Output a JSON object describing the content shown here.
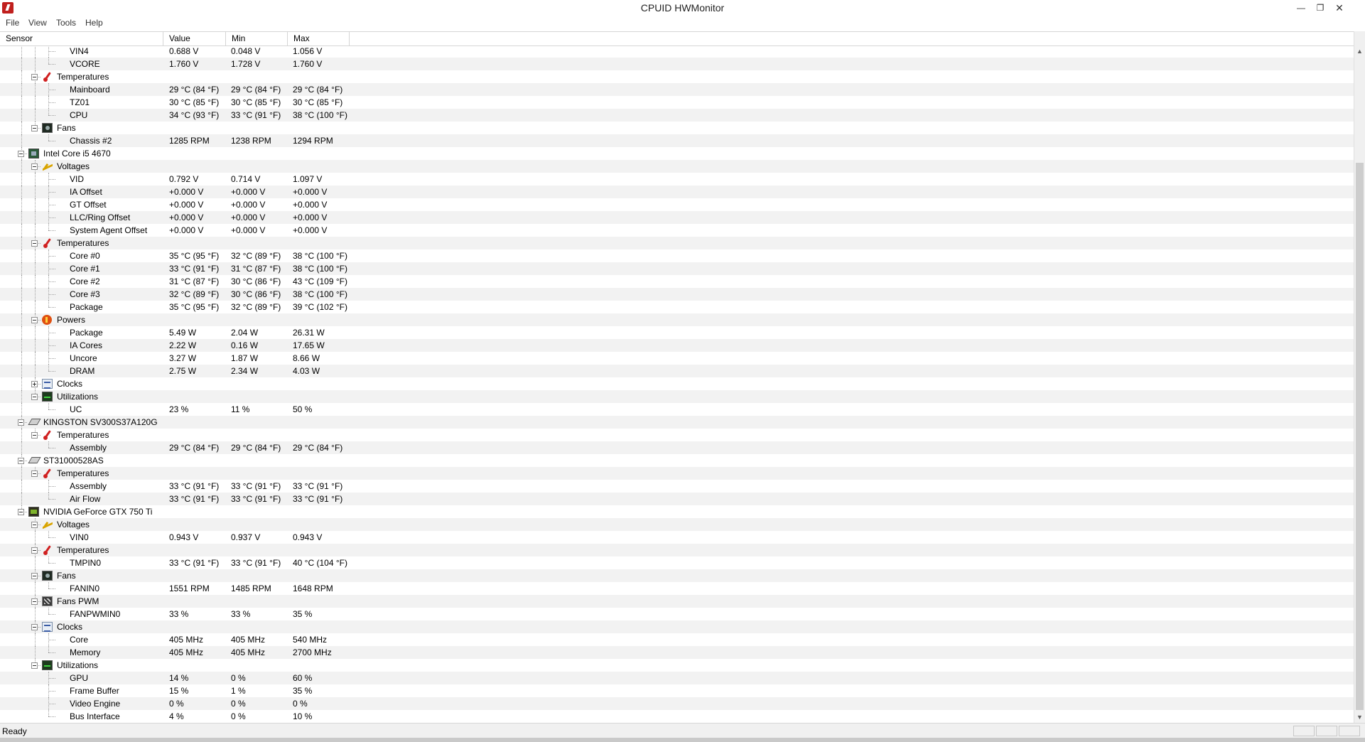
{
  "window": {
    "title": "CPUID HWMonitor"
  },
  "menu": [
    "File",
    "View",
    "Tools",
    "Help"
  ],
  "columns": {
    "sensor": "Sensor",
    "value": "Value",
    "min": "Min",
    "max": "Max"
  },
  "status": {
    "text": "Ready"
  },
  "rows": [
    {
      "level": 3,
      "label": "VIN4",
      "value": "0.688 V",
      "min": "0.048 V",
      "max": "1.056 V"
    },
    {
      "level": 3,
      "label": "VCORE",
      "value": "1.760 V",
      "min": "1.728 V",
      "max": "1.760 V"
    },
    {
      "level": 2,
      "label": "Temperatures",
      "icon": "temp",
      "expanded": true
    },
    {
      "level": 3,
      "label": "Mainboard",
      "value": "29 °C  (84 °F)",
      "min": "29 °C  (84 °F)",
      "max": "29 °C  (84 °F)"
    },
    {
      "level": 3,
      "label": "TZ01",
      "value": "30 °C  (85 °F)",
      "min": "30 °C  (85 °F)",
      "max": "30 °C  (85 °F)"
    },
    {
      "level": 3,
      "label": "CPU",
      "value": "34 °C  (93 °F)",
      "min": "33 °C  (91 °F)",
      "max": "38 °C  (100 °F)"
    },
    {
      "level": 2,
      "label": "Fans",
      "icon": "fan",
      "expanded": true
    },
    {
      "level": 3,
      "label": "Chassis #2",
      "value": "1285 RPM",
      "min": "1238 RPM",
      "max": "1294 RPM"
    },
    {
      "level": 1,
      "label": "Intel Core i5 4670",
      "icon": "cpu",
      "expanded": true
    },
    {
      "level": 2,
      "label": "Voltages",
      "icon": "volt",
      "expanded": true
    },
    {
      "level": 3,
      "label": "VID",
      "value": "0.792 V",
      "min": "0.714 V",
      "max": "1.097 V"
    },
    {
      "level": 3,
      "label": "IA Offset",
      "value": "+0.000 V",
      "min": "+0.000 V",
      "max": "+0.000 V"
    },
    {
      "level": 3,
      "label": "GT Offset",
      "value": "+0.000 V",
      "min": "+0.000 V",
      "max": "+0.000 V"
    },
    {
      "level": 3,
      "label": "LLC/Ring Offset",
      "value": "+0.000 V",
      "min": "+0.000 V",
      "max": "+0.000 V"
    },
    {
      "level": 3,
      "label": "System Agent Offset",
      "value": "+0.000 V",
      "min": "+0.000 V",
      "max": "+0.000 V"
    },
    {
      "level": 2,
      "label": "Temperatures",
      "icon": "temp",
      "expanded": true
    },
    {
      "level": 3,
      "label": "Core #0",
      "value": "35 °C  (95 °F)",
      "min": "32 °C  (89 °F)",
      "max": "38 °C  (100 °F)"
    },
    {
      "level": 3,
      "label": "Core #1",
      "value": "33 °C  (91 °F)",
      "min": "31 °C  (87 °F)",
      "max": "38 °C  (100 °F)"
    },
    {
      "level": 3,
      "label": "Core #2",
      "value": "31 °C  (87 °F)",
      "min": "30 °C  (86 °F)",
      "max": "43 °C  (109 °F)"
    },
    {
      "level": 3,
      "label": "Core #3",
      "value": "32 °C  (89 °F)",
      "min": "30 °C  (86 °F)",
      "max": "38 °C  (100 °F)"
    },
    {
      "level": 3,
      "label": "Package",
      "value": "35 °C  (95 °F)",
      "min": "32 °C  (89 °F)",
      "max": "39 °C  (102 °F)"
    },
    {
      "level": 2,
      "label": "Powers",
      "icon": "power",
      "expanded": true
    },
    {
      "level": 3,
      "label": "Package",
      "value": "5.49 W",
      "min": "2.04 W",
      "max": "26.31 W"
    },
    {
      "level": 3,
      "label": "IA Cores",
      "value": "2.22 W",
      "min": "0.16 W",
      "max": "17.65 W"
    },
    {
      "level": 3,
      "label": "Uncore",
      "value": "3.27 W",
      "min": "1.87 W",
      "max": "8.66 W"
    },
    {
      "level": 3,
      "label": "DRAM",
      "value": "2.75 W",
      "min": "2.34 W",
      "max": "4.03 W"
    },
    {
      "level": 2,
      "label": "Clocks",
      "icon": "clock",
      "expanded": false
    },
    {
      "level": 2,
      "label": "Utilizations",
      "icon": "util",
      "expanded": true
    },
    {
      "level": 3,
      "label": "UC",
      "value": "23 %",
      "min": "11 %",
      "max": "50 %"
    },
    {
      "level": 1,
      "label": "KINGSTON SV300S37A120G",
      "icon": "hdd",
      "expanded": true
    },
    {
      "level": 2,
      "label": "Temperatures",
      "icon": "temp",
      "expanded": true
    },
    {
      "level": 3,
      "label": "Assembly",
      "value": "29 °C  (84 °F)",
      "min": "29 °C  (84 °F)",
      "max": "29 °C  (84 °F)"
    },
    {
      "level": 1,
      "label": "ST31000528AS",
      "icon": "hdd",
      "expanded": true
    },
    {
      "level": 2,
      "label": "Temperatures",
      "icon": "temp",
      "expanded": true
    },
    {
      "level": 3,
      "label": "Assembly",
      "value": "33 °C  (91 °F)",
      "min": "33 °C  (91 °F)",
      "max": "33 °C  (91 °F)"
    },
    {
      "level": 3,
      "label": "Air Flow",
      "value": "33 °C  (91 °F)",
      "min": "33 °C  (91 °F)",
      "max": "33 °C  (91 °F)"
    },
    {
      "level": 1,
      "label": "NVIDIA GeForce GTX 750 Ti",
      "icon": "gpu",
      "expanded": true
    },
    {
      "level": 2,
      "label": "Voltages",
      "icon": "volt",
      "expanded": true
    },
    {
      "level": 3,
      "label": "VIN0",
      "value": "0.943 V",
      "min": "0.937 V",
      "max": "0.943 V"
    },
    {
      "level": 2,
      "label": "Temperatures",
      "icon": "temp",
      "expanded": true
    },
    {
      "level": 3,
      "label": "TMPIN0",
      "value": "33 °C  (91 °F)",
      "min": "33 °C  (91 °F)",
      "max": "40 °C  (104 °F)"
    },
    {
      "level": 2,
      "label": "Fans",
      "icon": "fan",
      "expanded": true
    },
    {
      "level": 3,
      "label": "FANIN0",
      "value": "1551 RPM",
      "min": "1485 RPM",
      "max": "1648 RPM"
    },
    {
      "level": 2,
      "label": "Fans PWM",
      "icon": "fanpwm",
      "expanded": true
    },
    {
      "level": 3,
      "label": "FANPWMIN0",
      "value": "33 %",
      "min": "33 %",
      "max": "35 %"
    },
    {
      "level": 2,
      "label": "Clocks",
      "icon": "clock",
      "expanded": true
    },
    {
      "level": 3,
      "label": "Core",
      "value": "405 MHz",
      "min": "405 MHz",
      "max": "540 MHz"
    },
    {
      "level": 3,
      "label": "Memory",
      "value": "405 MHz",
      "min": "405 MHz",
      "max": "2700 MHz"
    },
    {
      "level": 2,
      "label": "Utilizations",
      "icon": "util",
      "expanded": true
    },
    {
      "level": 3,
      "label": "GPU",
      "value": "14 %",
      "min": "0 %",
      "max": "60 %"
    },
    {
      "level": 3,
      "label": "Frame Buffer",
      "value": "15 %",
      "min": "1 %",
      "max": "35 %"
    },
    {
      "level": 3,
      "label": "Video Engine",
      "value": "0 %",
      "min": "0 %",
      "max": "0 %"
    },
    {
      "level": 3,
      "label": "Bus Interface",
      "value": "4 %",
      "min": "0 %",
      "max": "10 %"
    }
  ]
}
